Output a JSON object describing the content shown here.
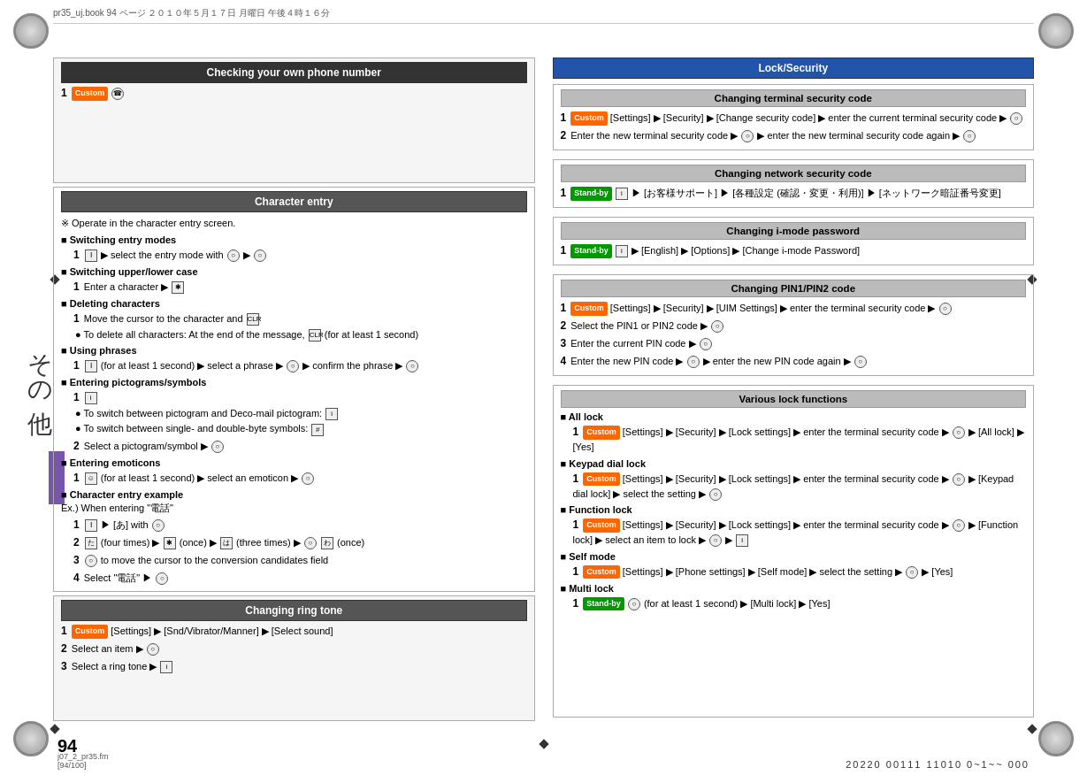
{
  "page": {
    "title": "pr35_uj.book  94 ページ  ２０１０年５月１７日  月曜日  午後４時１６分",
    "page_number": "94",
    "footer_file": "j07_2_pr35.fm",
    "footer_pages": "[94/100]",
    "footer_code": "20220 00111 11010 0~1~~ 000"
  },
  "left": {
    "section1_title": "Checking your own phone number",
    "section1_step1": "1",
    "section2_title": "Character entry",
    "note1": "※  Operate in the character entry screen.",
    "label_switching": "Switching entry modes",
    "step_switching": "select the entry mode with",
    "label_upper": "Switching upper/lower case",
    "step_upper1": "Enter a character",
    "label_deleting": "Deleting characters",
    "step_delete1": "Move the cursor to the character and",
    "bullet_delete1": "To delete all characters: At the end of the message,",
    "bullet_delete2": "(for at least 1 second)",
    "label_phrases": "Using phrases",
    "step_phrases1": "(for at least 1 second)",
    "step_phrases2": "select a phrase",
    "step_phrases3": "confirm the phrase",
    "label_pictograms": "Entering pictograms/symbols",
    "step_pict1": "",
    "bullet_pict1": "To switch between pictogram and Deco-mail pictogram:",
    "bullet_pict2": "To switch between single- and double-byte symbols:",
    "step_pict2": "Select a pictogram/symbol",
    "label_emoticons": "Entering emoticons",
    "step_emo1": "(for at least 1 second)",
    "step_emo2": "select an emoticon",
    "label_charex": "Character entry example",
    "ex_intro": "Ex.) When entering \"電話\"",
    "ex_step1": "[あ] with",
    "ex_step2": "(four times)",
    "ex_step2b": "(once)",
    "ex_step2c": "(three times)",
    "ex_step2d": "(once)",
    "ex_step3": "to move the cursor to the conversion candidates field",
    "ex_step4": "Select \"電話\"",
    "section3_title": "Changing ring tone",
    "ring_step1": "[Settings] ▶ [Snd/Vibrator/Manner] ▶ [Select sound]",
    "ring_step2": "Select an item ▶",
    "ring_step3": "Select a ring tone ▶",
    "japanese_text": "その他"
  },
  "right": {
    "main_title": "Lock/Security",
    "sec1_title": "Changing terminal security code",
    "sec1_step1a": "[Settings] ▶ [Security] ▶ [Change security code] ▶ enter the current terminal security code ▶",
    "sec1_step2a": "Enter the new terminal security code ▶",
    "sec1_step2b": "enter the new terminal security code again ▶",
    "sec2_title": "Changing network security code",
    "sec2_step1": "[お客様サポート] ▶ [各種設定 (確認・変更・利用)] ▶ [ネットワーク暗証番号変更]",
    "sec3_title": "Changing i-mode password",
    "sec3_step1": "[English] ▶ [Options] ▶ [Change i-mode Password]",
    "sec4_title": "Changing PIN1/PIN2 code",
    "sec4_step1": "[Settings] ▶ [Security] ▶ [UIM Settings] ▶ enter the terminal security code ▶",
    "sec4_step2": "Select the PIN1 or PIN2 code ▶",
    "sec4_step3": "Enter the current PIN code ▶",
    "sec4_step4": "Enter the new PIN code ▶",
    "sec4_step4b": "enter the new PIN code again ▶",
    "sec5_title": "Various lock functions",
    "label_alllock": "All lock",
    "alllock_step1": "[Settings] ▶ [Security] ▶ [Lock settings] ▶ enter the terminal security code ▶",
    "alllock_step1b": "[All lock] ▶ [Yes]",
    "label_keypad": "Keypad dial lock",
    "keypad_step1": "[Settings] ▶ [Security] ▶ [Lock settings] ▶ enter the terminal security code ▶",
    "keypad_step1b": "[Keypad dial lock] ▶ select the setting ▶",
    "label_function": "Function lock",
    "function_step1": "[Settings] ▶ [Security] ▶ [Lock settings] ▶ enter the terminal security code ▶",
    "function_step1b": "[Function lock] ▶ select an item to lock ▶",
    "label_self": "Self mode",
    "self_step1": "[Settings] ▶ [Phone settings] ▶ [Self mode] ▶ select the setting ▶",
    "self_step1b": "[Yes]",
    "label_multi": "Multi lock",
    "multi_step1": "(for at least 1 second) ▶ [Multi lock] ▶ [Yes]"
  },
  "badges": {
    "custom": "Custom",
    "standby": "Stand-by"
  }
}
